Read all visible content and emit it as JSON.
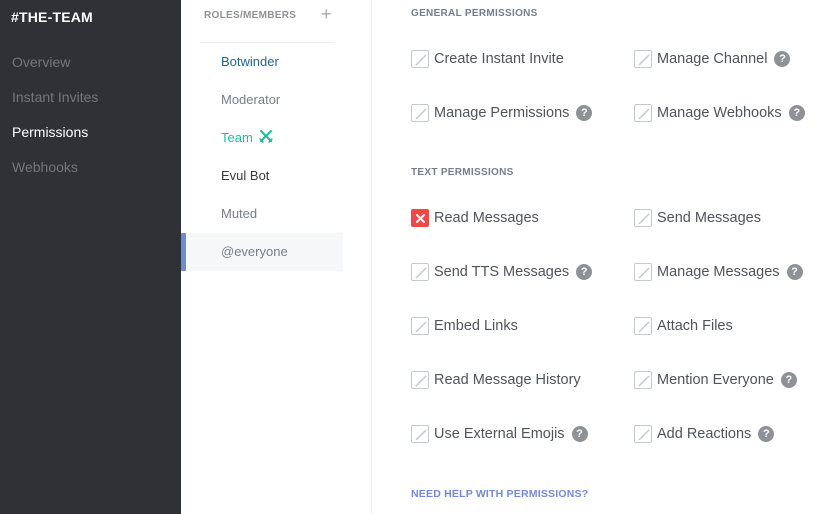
{
  "sidebar": {
    "title": "#THE-TEAM",
    "items": [
      {
        "label": "Overview"
      },
      {
        "label": "Instant Invites"
      },
      {
        "label": "Permissions"
      },
      {
        "label": "Webhooks"
      }
    ]
  },
  "roles": {
    "header": "ROLES/MEMBERS",
    "add_icon": "plus-icon",
    "items": [
      {
        "label": "Botwinder",
        "color": "#206694"
      },
      {
        "label": "Moderator",
        "color": "#747f8d"
      },
      {
        "label": "Team",
        "color": "#1abc9c"
      },
      {
        "label": "Evul Bot",
        "color": "#36393f"
      },
      {
        "label": "Muted",
        "color": "#747f8d"
      },
      {
        "label": "@everyone",
        "color": "#747f8d"
      }
    ]
  },
  "general": {
    "title": "GENERAL PERMISSIONS",
    "perms": [
      {
        "label": "Create Instant Invite"
      },
      {
        "label": "Manage Channel"
      },
      {
        "label": "Manage Permissions"
      },
      {
        "label": "Manage Webhooks"
      }
    ]
  },
  "text": {
    "title": "TEXT PERMISSIONS",
    "perms": [
      {
        "label": "Read Messages"
      },
      {
        "label": "Send Messages"
      },
      {
        "label": "Send TTS Messages"
      },
      {
        "label": "Manage Messages"
      },
      {
        "label": "Embed Links"
      },
      {
        "label": "Attach Files"
      },
      {
        "label": "Read Message History"
      },
      {
        "label": "Mention Everyone"
      },
      {
        "label": "Use External Emojis"
      },
      {
        "label": "Add Reactions"
      }
    ]
  },
  "help_glyph": "?",
  "help_link": "NEED HELP WITH PERMISSIONS?",
  "colors": {
    "accent": "#7289da",
    "deny": "#f04747",
    "sidebar_bg": "#2f3136"
  }
}
